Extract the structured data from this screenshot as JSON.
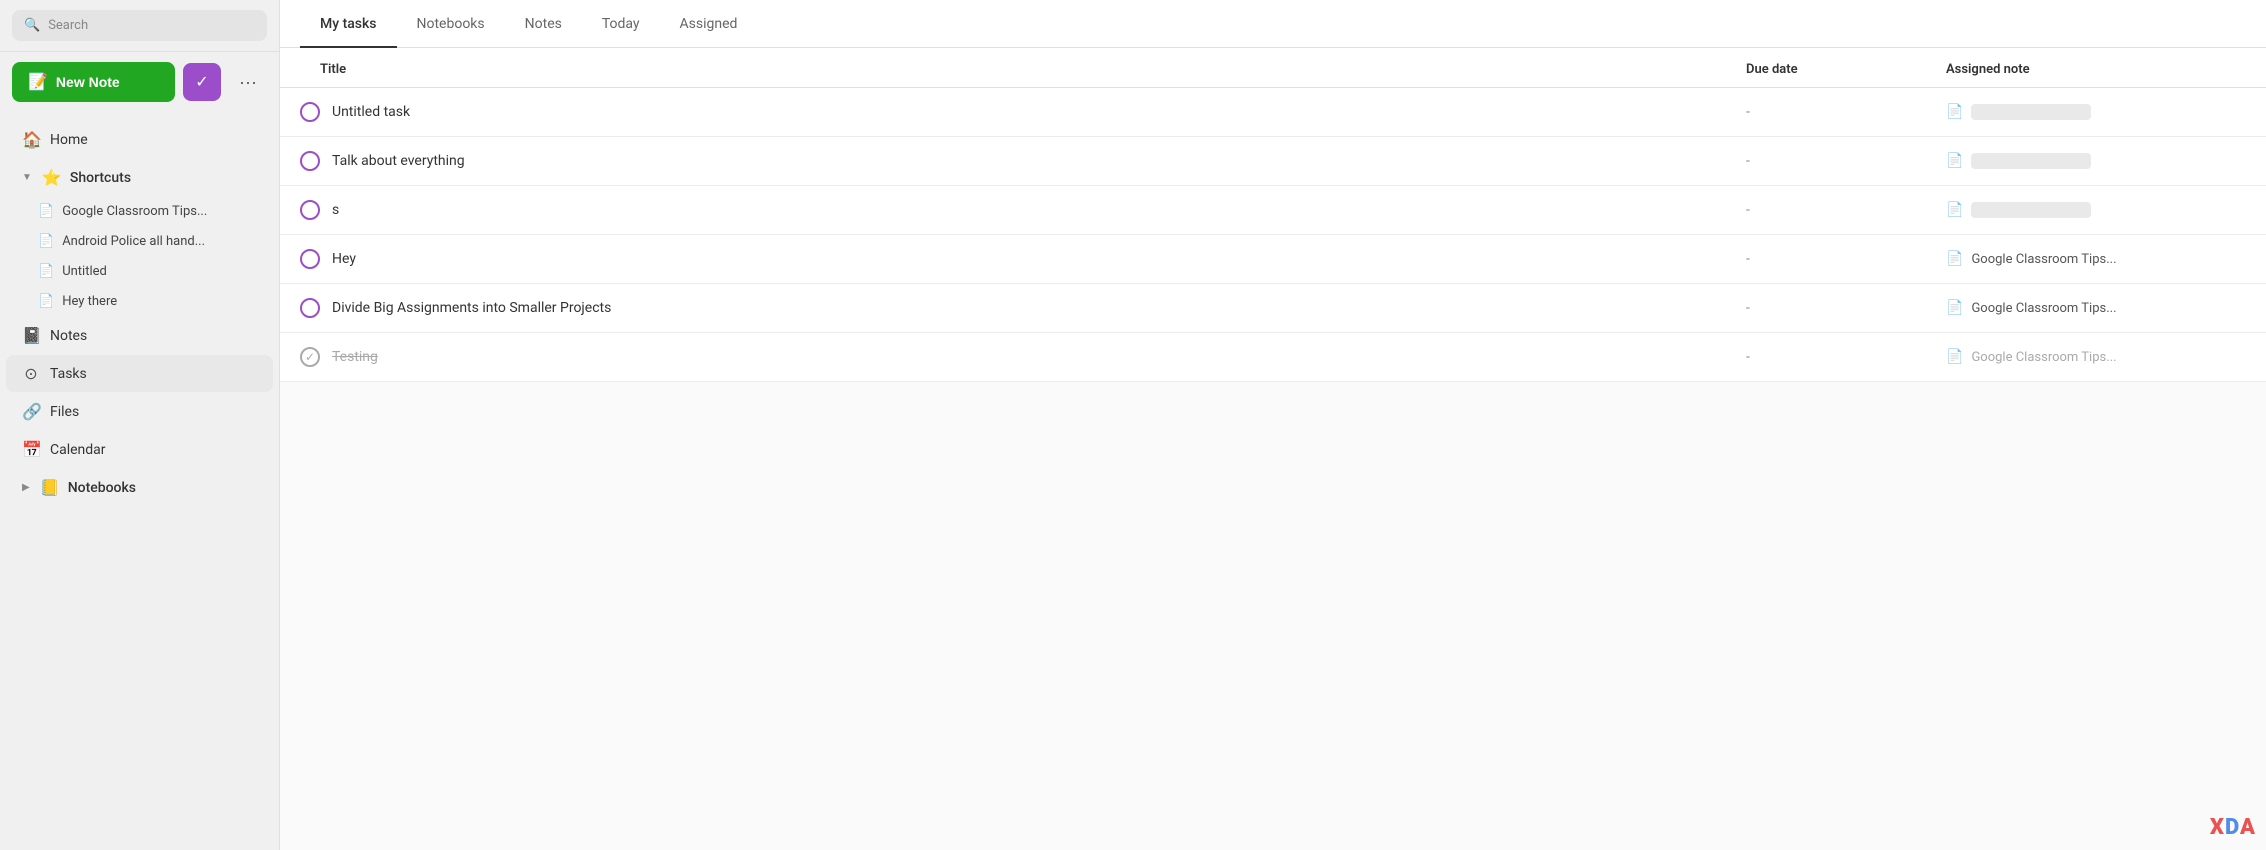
{
  "sidebar": {
    "search_placeholder": "Search",
    "new_note_label": "New Note",
    "more_label": "...",
    "nav_items": [
      {
        "id": "home",
        "label": "Home",
        "icon": "🏠"
      },
      {
        "id": "shortcuts",
        "label": "Shortcuts",
        "icon": "⭐",
        "has_chevron": true,
        "expanded": true
      },
      {
        "id": "notes",
        "label": "Notes",
        "icon": "📓"
      },
      {
        "id": "tasks",
        "label": "Tasks",
        "icon": "⊙",
        "active": true
      },
      {
        "id": "files",
        "label": "Files",
        "icon": "🔗"
      },
      {
        "id": "calendar",
        "label": "Calendar",
        "icon": "📅"
      },
      {
        "id": "notebooks",
        "label": "Notebooks",
        "icon": "📒",
        "has_chevron": true
      }
    ],
    "shortcuts_children": [
      {
        "id": "google-classroom",
        "label": "Google Classroom Tips...",
        "icon": "📄"
      },
      {
        "id": "android-police",
        "label": "Android Police all hand...",
        "icon": "📄"
      },
      {
        "id": "untitled",
        "label": "Untitled",
        "icon": "📄"
      },
      {
        "id": "hey-there",
        "label": "Hey there",
        "icon": "📄"
      }
    ]
  },
  "tabs": [
    {
      "id": "my-tasks",
      "label": "My tasks",
      "active": true
    },
    {
      "id": "notebooks",
      "label": "Notebooks"
    },
    {
      "id": "notes",
      "label": "Notes"
    },
    {
      "id": "today",
      "label": "Today"
    },
    {
      "id": "assigned",
      "label": "Assigned"
    }
  ],
  "table": {
    "columns": [
      {
        "id": "title",
        "label": "Title"
      },
      {
        "id": "due-date",
        "label": "Due date"
      },
      {
        "id": "assigned-note",
        "label": "Assigned note"
      }
    ],
    "rows": [
      {
        "id": "task-1",
        "title": "Untitled task",
        "due_date": "-",
        "assigned_note": "",
        "assigned_note_text": "",
        "completed": false,
        "blur_assigned": true
      },
      {
        "id": "task-2",
        "title": "Talk about everything",
        "due_date": "-",
        "assigned_note": "",
        "assigned_note_text": "",
        "completed": false,
        "blur_assigned": true
      },
      {
        "id": "task-3",
        "title": "s",
        "due_date": "-",
        "assigned_note": "",
        "assigned_note_text": "",
        "completed": false,
        "blur_assigned": true
      },
      {
        "id": "task-4",
        "title": "Hey",
        "due_date": "-",
        "assigned_note": "Google Classroom Tips...",
        "completed": false,
        "blur_assigned": false
      },
      {
        "id": "task-5",
        "title": "Divide Big Assignments into Smaller Projects",
        "due_date": "-",
        "assigned_note": "Google Classroom Tips...",
        "completed": false,
        "blur_assigned": false
      },
      {
        "id": "task-6",
        "title": "Testing",
        "due_date": "-",
        "assigned_note": "Google Classroom Tips...",
        "completed": true,
        "blur_assigned": false
      }
    ]
  }
}
